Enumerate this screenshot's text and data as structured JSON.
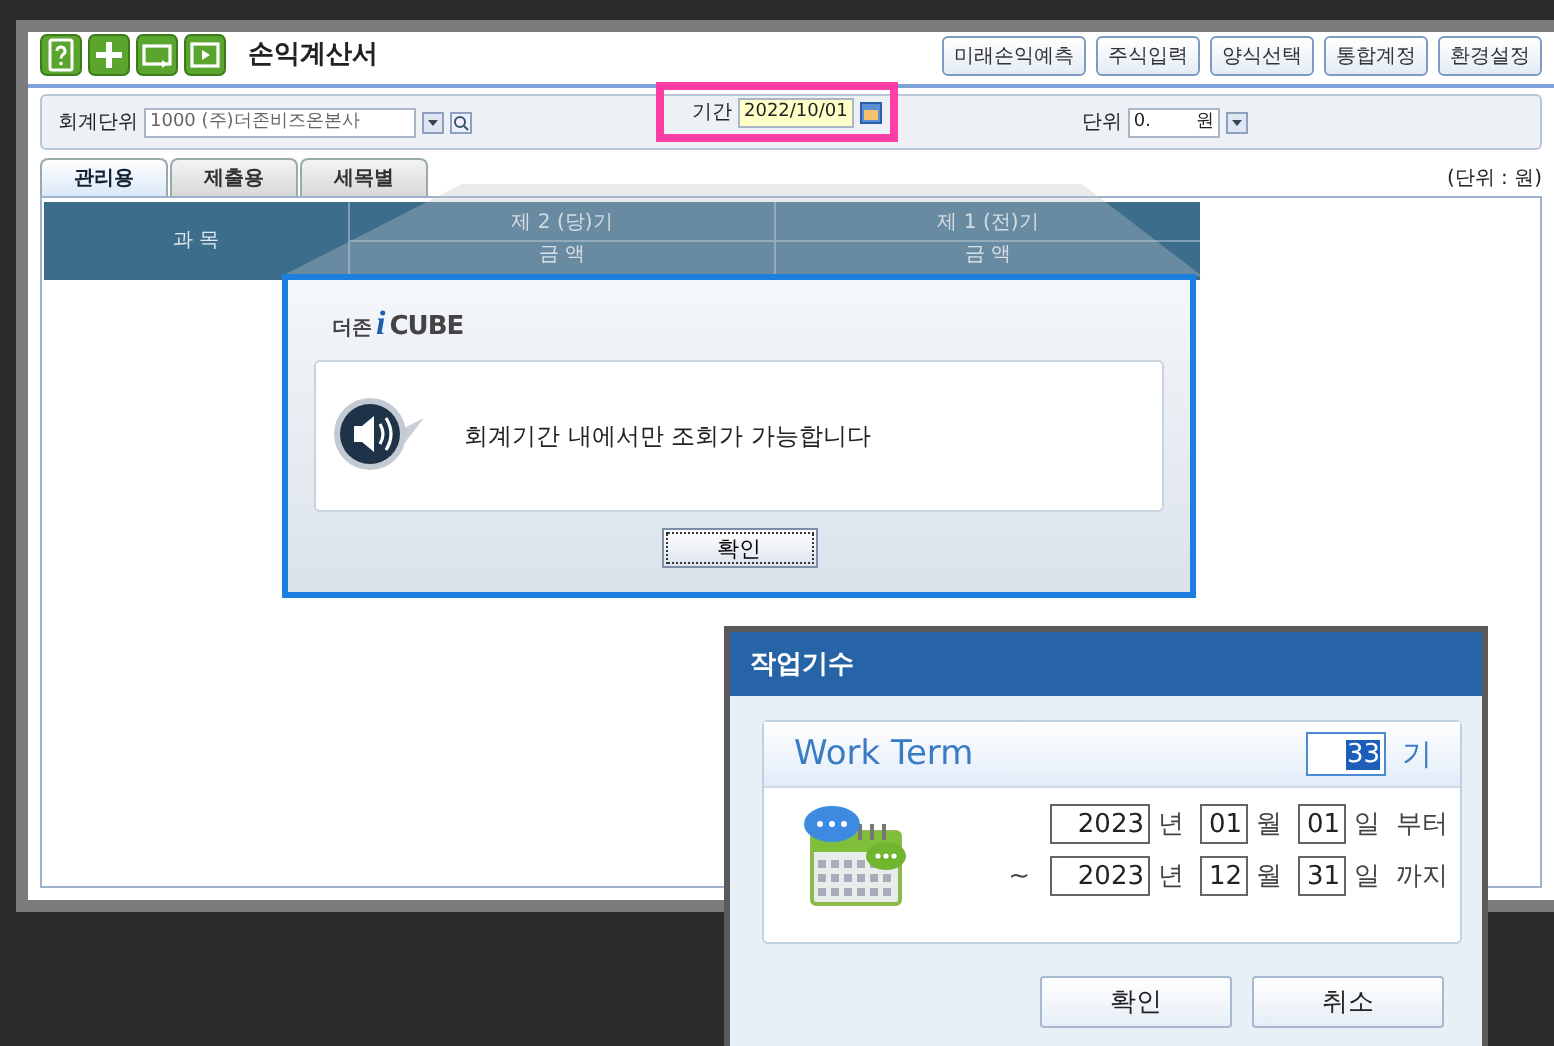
{
  "title": "손익계산서",
  "action_buttons": [
    "미래손익예측",
    "주식입력",
    "양식선택",
    "통합계정",
    "환경설정"
  ],
  "filters": {
    "unit_label": "회계단위",
    "unit_value": "1000 (주)더존비즈온본사",
    "period_label": "기간",
    "period_value": "2022/10/01",
    "currency_label": "단위",
    "currency_value": "0.",
    "currency_suffix": "원"
  },
  "tabs": [
    {
      "label": "관리용",
      "selected": true
    },
    {
      "label": "제출용",
      "selected": false
    },
    {
      "label": "세목별",
      "selected": false
    }
  ],
  "unit_note": "(단위 : 원)",
  "table": {
    "columns": [
      {
        "label": "과 목"
      },
      {
        "label": "제 2 (당)기",
        "sub": "금 액"
      },
      {
        "label": "제 1 (전)기",
        "sub": "금 액"
      }
    ]
  },
  "alert": {
    "logo_prefix": "더존",
    "logo_mark": "i",
    "logo_name": "CUBE",
    "message": "회계기간 내에서만 조회가 가능합니다",
    "button": "확인"
  },
  "work_term": {
    "title": "작업기수",
    "heading": "Work Term",
    "term_value": "33",
    "term_selected": true,
    "term_suffix": "기",
    "rows": [
      {
        "prefix": "",
        "fields": [
          {
            "value": "2023",
            "unit": "년"
          },
          {
            "value": "01",
            "unit": "월"
          },
          {
            "value": "01",
            "unit": "일"
          }
        ],
        "suffix": "부터"
      },
      {
        "prefix": "~",
        "fields": [
          {
            "value": "2023",
            "unit": "년"
          },
          {
            "value": "12",
            "unit": "월"
          },
          {
            "value": "31",
            "unit": "일"
          }
        ],
        "suffix": "까지"
      }
    ],
    "buttons": [
      "확인",
      "취소"
    ]
  }
}
